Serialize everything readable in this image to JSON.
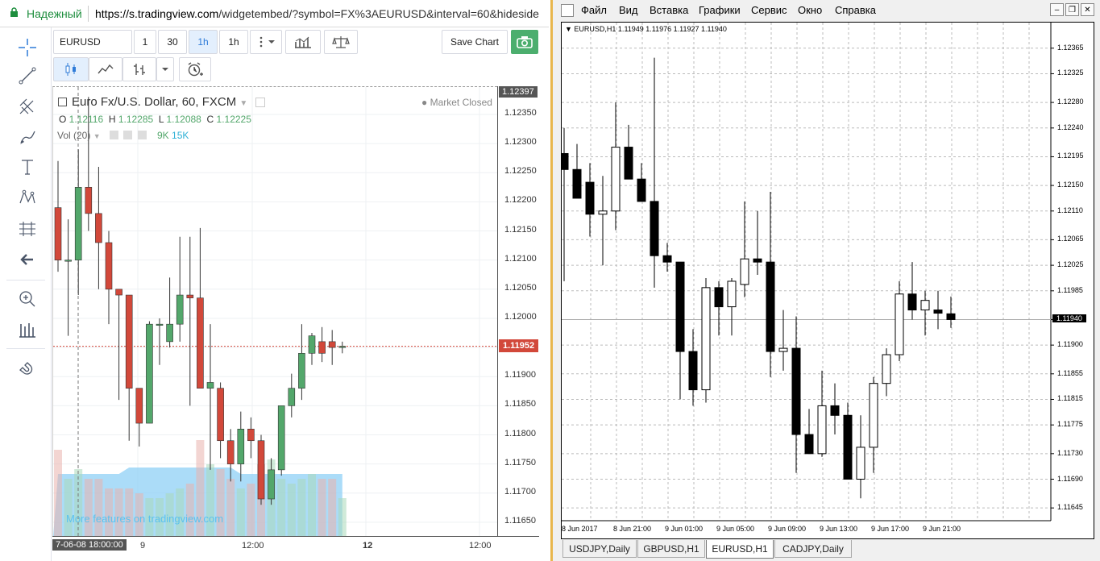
{
  "browser": {
    "secure_label": "Надежный",
    "url_host": "https://s.tradingview.com",
    "url_path": "/widgetembed/?symbol=FX%3AEURUSD&interval=60&hideside"
  },
  "tv": {
    "toolbar": {
      "symbol": "EURUSD",
      "intervals": [
        "1",
        "30",
        "1h",
        "1h"
      ],
      "save_chart_label": "Save Chart"
    },
    "legend": {
      "title": "Euro Fx/U.S. Dollar, 60, FXCM",
      "market_status": "Market Closed",
      "ohlc": {
        "O": "1.12116",
        "H": "1.12285",
        "L": "1.12088",
        "C": "1.12225"
      },
      "vol_label": "Vol (20)",
      "vol_values": [
        "9K",
        "15K"
      ]
    },
    "watermark": "More features on tradingview.com",
    "price_ticks": [
      "1.12350",
      "1.12300",
      "1.12250",
      "1.12200",
      "1.12150",
      "1.12100",
      "1.12050",
      "1.12000",
      "1.11950",
      "1.11900",
      "1.11850",
      "1.11800",
      "1.11750",
      "1.11700",
      "1.11650"
    ],
    "top_price_label": "1.12397",
    "last_price_label": "1.11952",
    "time_cursor_label": "7-06-08 18:00:00",
    "time_ticks": [
      "9",
      "12:00",
      "12",
      "12:00"
    ],
    "colors": {
      "up": "#53a76b",
      "down": "#d2483a",
      "volume_area": "#8fd0f6"
    }
  },
  "mt4": {
    "menu": [
      "Файл",
      "Вид",
      "Вставка",
      "Графики",
      "Сервис",
      "Окно",
      "Справка"
    ],
    "header": "EURUSD,H1  1.11949 1.11976 1.11927 1.11940",
    "price_ticks": [
      "1.12365",
      "1.12325",
      "1.12280",
      "1.12240",
      "1.12195",
      "1.12150",
      "1.12110",
      "1.12065",
      "1.12025",
      "1.11985",
      "1.11940",
      "1.11900",
      "1.11855",
      "1.11815",
      "1.11775",
      "1.11730",
      "1.11690",
      "1.11645"
    ],
    "current_price_label": "1.11940",
    "time_ticks": [
      "8 Jun 2017",
      "8 Jun 21:00",
      "9 Jun 01:00",
      "9 Jun 05:00",
      "9 Jun 09:00",
      "9 Jun 13:00",
      "9 Jun 17:00",
      "9 Jun 21:00"
    ],
    "tabs": [
      "USDJPY,Daily",
      "GBPUSD,H1",
      "EURUSD,H1",
      "CADJPY,Daily"
    ],
    "active_tab": "EURUSD,H1"
  },
  "chart_data": [
    {
      "type": "candlestick",
      "title": "Euro Fx/U.S. Dollar, 60, FXCM",
      "ylim": [
        1.11625,
        1.12397
      ],
      "x_labels": [
        "9",
        "12:00",
        "12",
        "12:00"
      ],
      "candles": [
        {
          "o": 1.1219,
          "h": 1.1227,
          "l": 1.1208,
          "c": 1.121
        },
        {
          "o": 1.121,
          "h": 1.1217,
          "l": 1.1197,
          "c": 1.121
        },
        {
          "o": 1.121,
          "h": 1.1229,
          "l": 1.1204,
          "c": 1.12225
        },
        {
          "o": 1.12225,
          "h": 1.1238,
          "l": 1.1215,
          "c": 1.1218
        },
        {
          "o": 1.1218,
          "h": 1.1226,
          "l": 1.1205,
          "c": 1.1213
        },
        {
          "o": 1.1213,
          "h": 1.1215,
          "l": 1.1199,
          "c": 1.1205
        },
        {
          "o": 1.1205,
          "h": 1.1205,
          "l": 1.1186,
          "c": 1.1204
        },
        {
          "o": 1.1204,
          "h": 1.1204,
          "l": 1.1179,
          "c": 1.1188
        },
        {
          "o": 1.1188,
          "h": 1.1188,
          "l": 1.1178,
          "c": 1.1182
        },
        {
          "o": 1.1182,
          "h": 1.11995,
          "l": 1.1182,
          "c": 1.1199
        },
        {
          "o": 1.1199,
          "h": 1.12,
          "l": 1.1192,
          "c": 1.1199
        },
        {
          "o": 1.1196,
          "h": 1.1207,
          "l": 1.1195,
          "c": 1.1199
        },
        {
          "o": 1.1199,
          "h": 1.1214,
          "l": 1.1196,
          "c": 1.1204
        },
        {
          "o": 1.1204,
          "h": 1.1214,
          "l": 1.1185,
          "c": 1.12035
        },
        {
          "o": 1.12035,
          "h": 1.12155,
          "l": 1.1188,
          "c": 1.1188
        },
        {
          "o": 1.1188,
          "h": 1.1199,
          "l": 1.1174,
          "c": 1.1189
        },
        {
          "o": 1.1188,
          "h": 1.1189,
          "l": 1.1176,
          "c": 1.1179
        },
        {
          "o": 1.1179,
          "h": 1.1181,
          "l": 1.1172,
          "c": 1.1175
        },
        {
          "o": 1.1175,
          "h": 1.1184,
          "l": 1.1172,
          "c": 1.1181
        },
        {
          "o": 1.1181,
          "h": 1.1183,
          "l": 1.1176,
          "c": 1.1179
        },
        {
          "o": 1.1179,
          "h": 1.118,
          "l": 1.1168,
          "c": 1.1169
        },
        {
          "o": 1.1169,
          "h": 1.1176,
          "l": 1.1168,
          "c": 1.1174
        },
        {
          "o": 1.1174,
          "h": 1.1185,
          "l": 1.1173,
          "c": 1.1185
        },
        {
          "o": 1.1185,
          "h": 1.11905,
          "l": 1.1183,
          "c": 1.1188
        },
        {
          "o": 1.1188,
          "h": 1.1199,
          "l": 1.1186,
          "c": 1.1194
        },
        {
          "o": 1.1194,
          "h": 1.11975,
          "l": 1.1192,
          "c": 1.1197
        },
        {
          "o": 1.1196,
          "h": 1.11985,
          "l": 1.11925,
          "c": 1.1194
        },
        {
          "o": 1.1196,
          "h": 1.1198,
          "l": 1.1192,
          "c": 1.1195
        },
        {
          "o": 1.1195,
          "h": 1.1196,
          "l": 1.1194,
          "c": 1.11952
        }
      ],
      "volume": [
        0.9,
        0.6,
        0.7,
        0.6,
        0.6,
        0.5,
        0.5,
        0.5,
        0.45,
        0.4,
        0.4,
        0.45,
        0.5,
        0.55,
        1.0,
        0.75,
        0.7,
        0.6,
        0.5,
        0.55,
        0.75,
        0.8,
        0.6,
        0.55,
        0.6,
        0.65,
        0.6,
        0.6,
        0.4
      ]
    },
    {
      "type": "candlestick",
      "title": "EURUSD,H1",
      "ylim": [
        1.11625,
        1.12395
      ],
      "x_labels": [
        "8 Jun 2017",
        "8 Jun 21:00",
        "9 Jun 01:00",
        "9 Jun 05:00",
        "9 Jun 09:00",
        "9 Jun 13:00",
        "9 Jun 17:00",
        "9 Jun 21:00"
      ],
      "candles": [
        {
          "o": 1.122,
          "h": 1.1224,
          "l": 1.12,
          "c": 1.12175
        },
        {
          "o": 1.12175,
          "h": 1.12215,
          "l": 1.1213,
          "c": 1.1213
        },
        {
          "o": 1.12155,
          "h": 1.12185,
          "l": 1.1207,
          "c": 1.12105
        },
        {
          "o": 1.12105,
          "h": 1.12165,
          "l": 1.12025,
          "c": 1.1211
        },
        {
          "o": 1.1211,
          "h": 1.1228,
          "l": 1.1208,
          "c": 1.1221
        },
        {
          "o": 1.1221,
          "h": 1.12245,
          "l": 1.1216,
          "c": 1.1216
        },
        {
          "o": 1.1216,
          "h": 1.12185,
          "l": 1.12135,
          "c": 1.12125
        },
        {
          "o": 1.12125,
          "h": 1.1235,
          "l": 1.1199,
          "c": 1.1204
        },
        {
          "o": 1.1204,
          "h": 1.1206,
          "l": 1.12015,
          "c": 1.1203
        },
        {
          "o": 1.1203,
          "h": 1.1203,
          "l": 1.11815,
          "c": 1.1189
        },
        {
          "o": 1.1189,
          "h": 1.11925,
          "l": 1.11805,
          "c": 1.1183
        },
        {
          "o": 1.1183,
          "h": 1.12005,
          "l": 1.1181,
          "c": 1.1199
        },
        {
          "o": 1.1199,
          "h": 1.12,
          "l": 1.11915,
          "c": 1.1196
        },
        {
          "o": 1.1196,
          "h": 1.12005,
          "l": 1.11915,
          "c": 1.12
        },
        {
          "o": 1.11995,
          "h": 1.12125,
          "l": 1.11975,
          "c": 1.12035
        },
        {
          "o": 1.12035,
          "h": 1.1211,
          "l": 1.1201,
          "c": 1.1203
        },
        {
          "o": 1.1203,
          "h": 1.1214,
          "l": 1.1185,
          "c": 1.1189
        },
        {
          "o": 1.1189,
          "h": 1.11955,
          "l": 1.1186,
          "c": 1.11895
        },
        {
          "o": 1.11895,
          "h": 1.11945,
          "l": 1.117,
          "c": 1.1176
        },
        {
          "o": 1.1176,
          "h": 1.118,
          "l": 1.1173,
          "c": 1.1173
        },
        {
          "o": 1.1173,
          "h": 1.1186,
          "l": 1.11725,
          "c": 1.11805
        },
        {
          "o": 1.11805,
          "h": 1.1184,
          "l": 1.1176,
          "c": 1.1179
        },
        {
          "o": 1.1179,
          "h": 1.1181,
          "l": 1.1169,
          "c": 1.1169
        },
        {
          "o": 1.1169,
          "h": 1.1179,
          "l": 1.1166,
          "c": 1.1174
        },
        {
          "o": 1.1174,
          "h": 1.1185,
          "l": 1.117,
          "c": 1.1184
        },
        {
          "o": 1.1184,
          "h": 1.11895,
          "l": 1.1182,
          "c": 1.11885
        },
        {
          "o": 1.11885,
          "h": 1.12,
          "l": 1.11875,
          "c": 1.1198
        },
        {
          "o": 1.1198,
          "h": 1.1203,
          "l": 1.1194,
          "c": 1.11955
        },
        {
          "o": 1.11955,
          "h": 1.11985,
          "l": 1.11915,
          "c": 1.1197
        },
        {
          "o": 1.11955,
          "h": 1.11985,
          "l": 1.11925,
          "c": 1.1195
        },
        {
          "o": 1.11949,
          "h": 1.11976,
          "l": 1.11927,
          "c": 1.1194
        }
      ]
    }
  ]
}
